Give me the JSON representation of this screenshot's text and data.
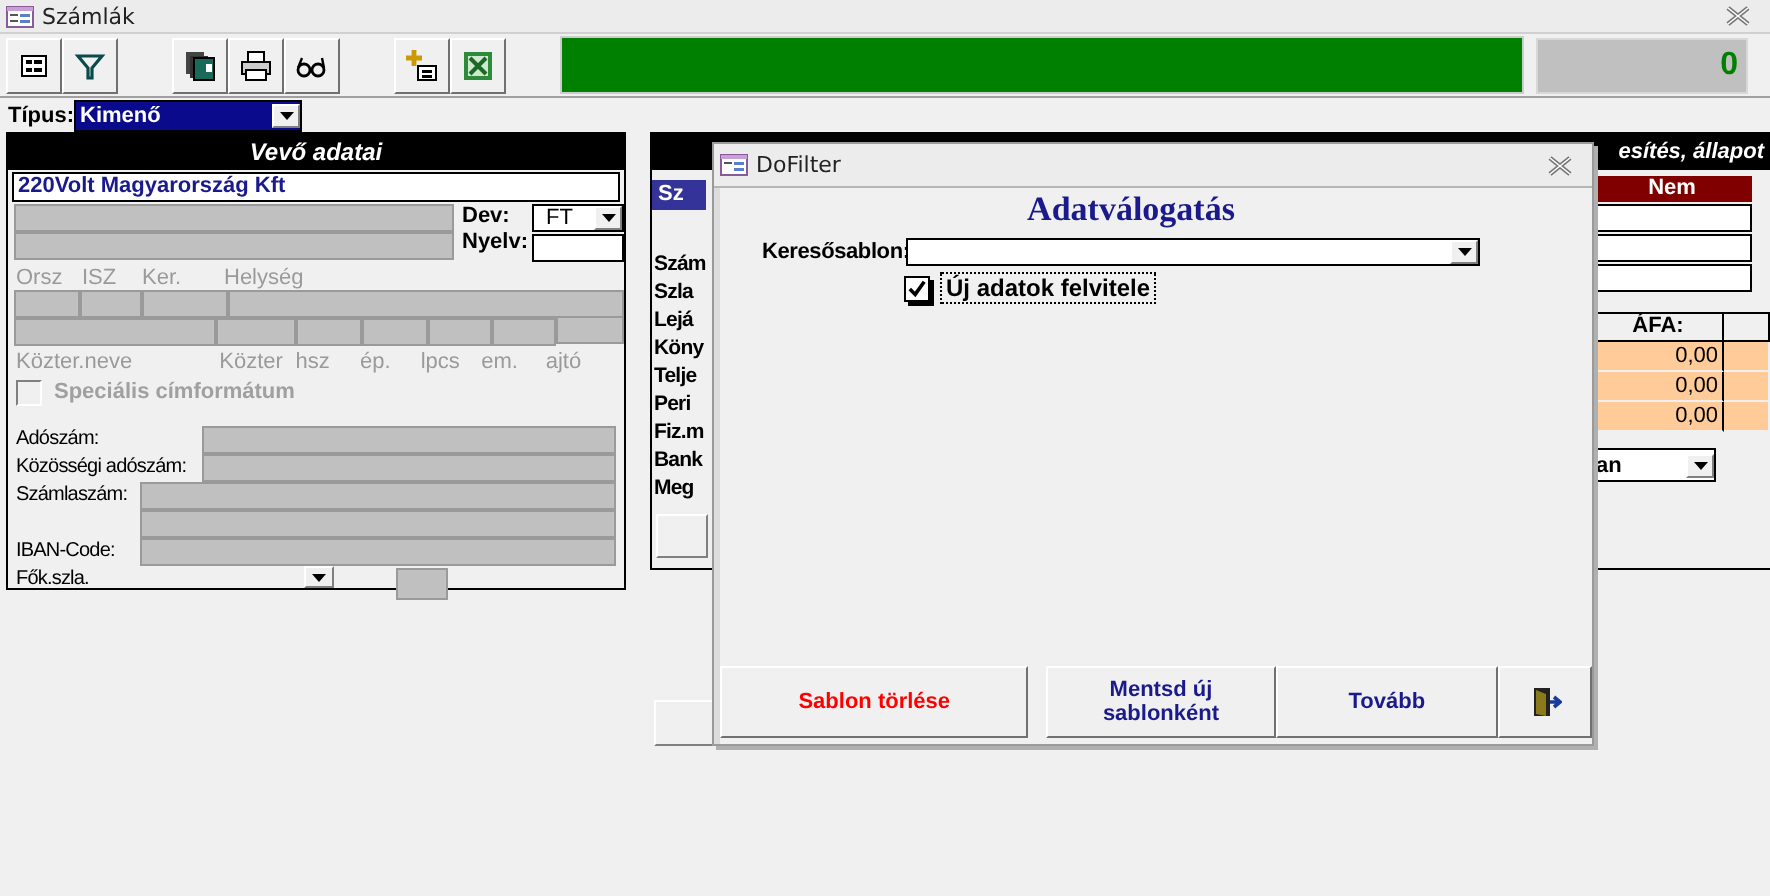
{
  "window": {
    "title": "Számlák"
  },
  "toolbar": {
    "groups": [
      [
        {
          "kind": "form"
        },
        {
          "kind": "filter"
        }
      ],
      [
        {
          "kind": "copy"
        },
        {
          "kind": "print"
        },
        {
          "kind": "view"
        }
      ],
      [
        {
          "kind": "add"
        },
        {
          "kind": "excel"
        }
      ]
    ]
  },
  "progress": {
    "level": 1,
    "count": "0"
  },
  "type_filter": {
    "label": "Típus:",
    "value": "Kimenő"
  },
  "customer": {
    "title": "Vevő adatai",
    "name": "220Volt Magyarország Kft",
    "currency_label": "Dev:",
    "currency": "FT",
    "language_label": "Nyelv:",
    "address_labels_top": [
      "Orsz",
      "ISZ",
      "Ker.",
      "Helység"
    ],
    "address_labels_bottom": [
      "Közter.neve",
      "Közter",
      "hsz",
      "ép.",
      "lpcs",
      "em.",
      "ajtó"
    ],
    "special_format": {
      "label": "Speciális címformátum",
      "checked": false,
      "disabled": true
    },
    "id_fields": [
      {
        "label": "Adószám:",
        "kind": "short"
      },
      {
        "label": "Közösségi adószám:",
        "kind": "short"
      },
      {
        "label": "Számlaszám:",
        "kind": "long-double"
      },
      {
        "label": "IBAN-Code:",
        "kind": "long"
      }
    ],
    "main_account_label": "Fők.szla."
  },
  "invoice": {
    "header": "esítés, állapot",
    "tab": "Sz",
    "labels": [
      "Szám",
      "Szla",
      "Lejá",
      "Köny",
      "Telje",
      "Peri",
      "Fiz.m",
      "Bank",
      "Meg"
    ],
    "status_header": "Nem",
    "vat_header": "ÁFA:",
    "vat_values": [
      "0,00",
      "0,00",
      "0,00"
    ],
    "dropdown_value": "an"
  },
  "dialog": {
    "title": "DoFilter",
    "heading": "Adatválogatás",
    "template_label": "Keresősablon:",
    "new_entry": {
      "label": "Új adatok felvitele",
      "checked": true
    },
    "buttons": [
      {
        "kind": "danger",
        "label": "Sablon törlése"
      },
      {
        "kind": "normal",
        "label": "Mentsd új sablonként"
      },
      {
        "kind": "normal",
        "label": "Tovább"
      },
      {
        "kind": "exit"
      }
    ]
  }
}
